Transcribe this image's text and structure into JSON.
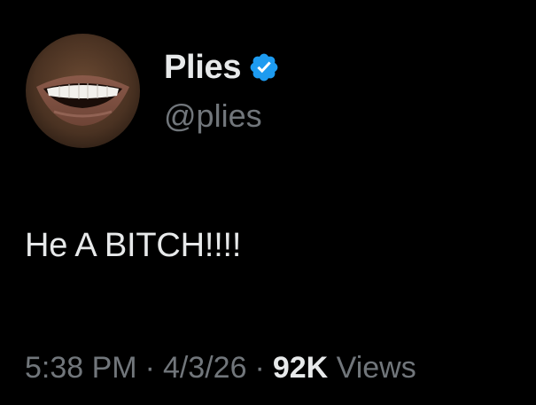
{
  "author": {
    "display_name": "Plies",
    "handle": "@plies",
    "verified": true,
    "avatar_icon": "smiling-mouth-avatar",
    "verified_icon": "verified-badge-icon"
  },
  "tweet": {
    "text": "He A BITCH!!!!"
  },
  "meta": {
    "time": "5:38 PM",
    "date": "4/3/26",
    "separator": "·",
    "views_count": "92K",
    "views_label": "Views"
  },
  "colors": {
    "background": "#000000",
    "primary_text": "#e7e9ea",
    "secondary_text": "#71767b",
    "verified_blue": "#1d9bf0"
  }
}
